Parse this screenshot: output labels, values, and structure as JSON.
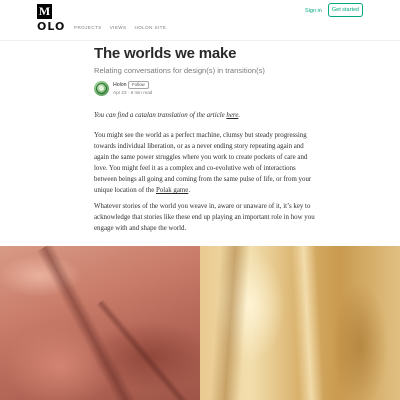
{
  "header": {
    "site_logo": "M",
    "signin_label": "Sign in",
    "get_started_label": "Get started"
  },
  "publication": {
    "logo": "OLO",
    "nav": [
      "PROJECTS",
      "VIEWS",
      "HOLON SITE"
    ]
  },
  "article": {
    "title": "The worlds we make",
    "subtitle": "Relating conversations for design(s) in transition(s)",
    "author": {
      "name": "Holon",
      "follow_label": "Follow",
      "meta": "Apr 23 · 8 min read"
    },
    "p1_text": "You can find a catalan translation of the article ",
    "p1_link": "here",
    "p1_end": ".",
    "p2_text": "You might see the world as a perfect machine, clumsy but steady progressing towards individual liberation, or as a never ending story repeating again and again the same power struggles where you work to create pockets of care and love. You might feel it as a complex and co-evolutive web of interactions between beings all going and coming from the same pulse of life, or from your unique location of the ",
    "p2_link": "Polak game",
    "p2_end": ".",
    "p3_text": "Whatever stories of the world you weave in, aware or unaware of it, it’s key to acknowledge that stories like these end up playing an important role in how you engage with and shape the world."
  },
  "colors": {
    "accent": "#03a87c",
    "text": "#292929",
    "muted": "#757575"
  },
  "icons": {
    "avatar": "avatar-image"
  }
}
